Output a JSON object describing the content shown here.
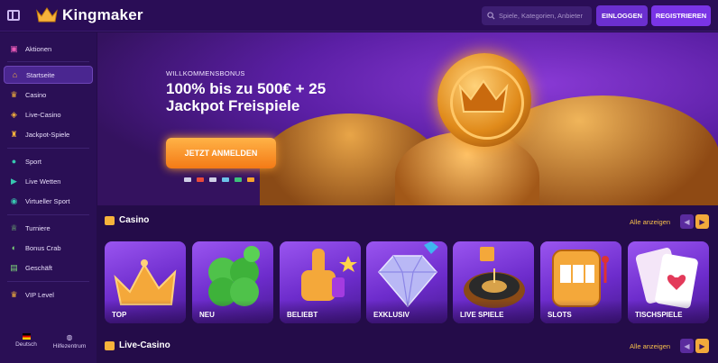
{
  "header": {
    "logo_text": "Kingmaker",
    "search_placeholder": "Spiele, Kategorien, Anbieter",
    "login_label": "EINLOGGEN",
    "register_label": "REGISTRIEREN"
  },
  "sidebar": {
    "items": [
      {
        "label": "Aktionen",
        "icon": "gift-icon"
      },
      {
        "label": "Startseite",
        "icon": "home-icon",
        "active": true
      },
      {
        "label": "Casino",
        "icon": "casino-icon"
      },
      {
        "label": "Live-Casino",
        "icon": "live-casino-icon"
      },
      {
        "label": "Jackpot-Spiele",
        "icon": "jackpot-icon"
      },
      {
        "label": "Sport",
        "icon": "sport-ball-icon"
      },
      {
        "label": "Live Wetten",
        "icon": "live-bet-icon"
      },
      {
        "label": "Virtueller Sport",
        "icon": "virtual-sport-icon"
      },
      {
        "label": "Turniere",
        "icon": "trophy-icon"
      },
      {
        "label": "Bonus Crab",
        "icon": "crab-icon"
      },
      {
        "label": "Geschäft",
        "icon": "shop-icon"
      },
      {
        "label": "VIP Level",
        "icon": "crown-icon"
      }
    ],
    "footer": {
      "language": "Deutsch",
      "help": "Hilfezentrum"
    }
  },
  "hero": {
    "kicker": "WILLKOMMENSBONUS",
    "headline": "100% bis zu 500€ + 25 Jackpot Freispiele",
    "cta": "JETZT ANMELDEN"
  },
  "sections": {
    "casino": {
      "title": "Casino",
      "see_all": "Alle anzeigen",
      "cards": [
        "TOP",
        "NEU",
        "BELIEBT",
        "EXKLUSIV",
        "LIVE SPIELE",
        "SLOTS",
        "TISCHSPIELE"
      ]
    },
    "live_casino": {
      "title": "Live-Casino",
      "see_all": "Alle anzeigen"
    }
  },
  "colors": {
    "background": "#240c49",
    "accent_orange": "#f47a16",
    "accent_purple": "#7a34e6",
    "link_gold": "#f7c04b"
  }
}
